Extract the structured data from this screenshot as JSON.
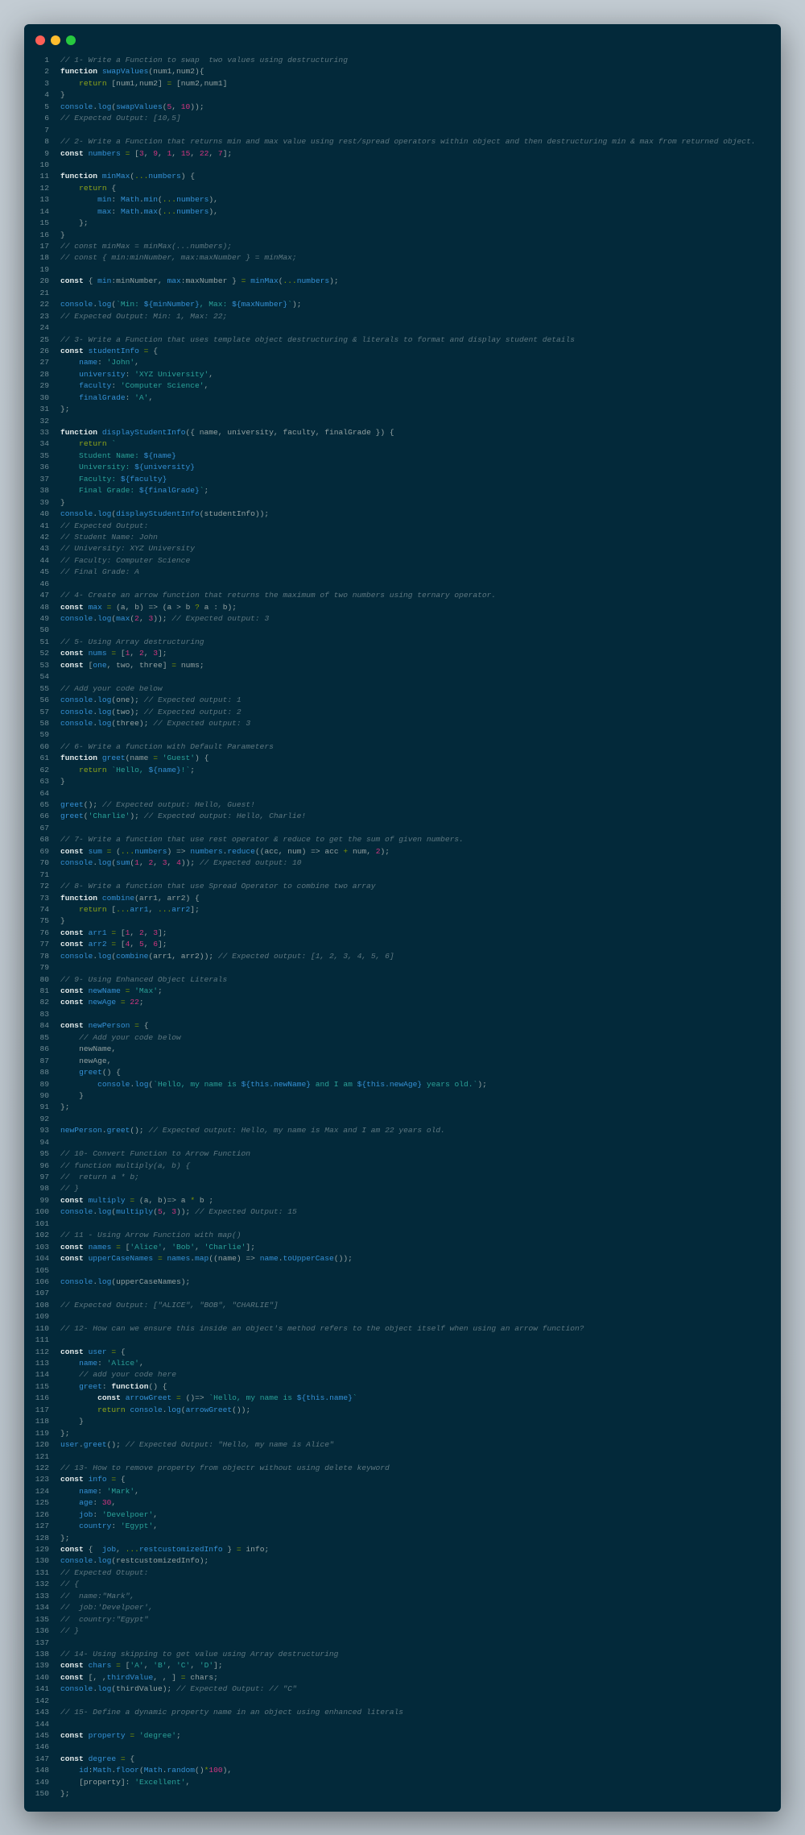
{
  "window": {
    "controls": [
      {
        "name": "close",
        "color": "#ff5f56"
      },
      {
        "name": "minimize",
        "color": "#ffbd2e"
      },
      {
        "name": "zoom",
        "color": "#27c93f"
      }
    ]
  },
  "theme": {
    "background": "#03293a",
    "keyword": "#e4ebeb",
    "identifier": "#3591d6",
    "string": "#2aa198",
    "number": "#d33682",
    "comment": "#5d7780"
  },
  "code": {
    "lines": [
      "// 1- Write a Function to swap  two values using destructuring",
      "function swapValues(num1,num2){",
      "    return [num1,num2] = [num2,num1]",
      "}",
      "console.log(swapValues(5, 10));",
      "// Expected Output: [10,5]",
      "",
      "// 2- Write a Function that returns min and max value using rest/spread operators within object and then destructuring min & max from returned object.",
      "const numbers = [3, 9, 1, 15, 22, 7];",
      "",
      "function minMax(...numbers) {",
      "    return {",
      "        min: Math.min(...numbers),",
      "        max: Math.max(...numbers),",
      "    };",
      "}",
      "// const minMax = minMax(...numbers);",
      "// const { min:minNumber, max:maxNumber } = minMax;",
      "",
      "const { min:minNumber, max:maxNumber } = minMax(...numbers);",
      "",
      "console.log(`Min: ${minNumber}, Max: ${maxNumber}`);",
      "// Expected Output: Min: 1, Max: 22;",
      "",
      "// 3- Write a Function that uses template object destructuring & literals to format and display student details",
      "const studentInfo = {",
      "    name: 'John',",
      "    university: 'XYZ University',",
      "    faculty: 'Computer Science',",
      "    finalGrade: 'A',",
      "};",
      "",
      "function displayStudentInfo({ name, university, faculty, finalGrade }) {",
      "    return `",
      "    Student Name: ${name}",
      "    University: ${university}",
      "    Faculty: ${faculty}",
      "    Final Grade: ${finalGrade}`;",
      "}",
      "console.log(displayStudentInfo(studentInfo));",
      "// Expected Output:",
      "// Student Name: John",
      "// University: XYZ University",
      "// Faculty: Computer Science",
      "// Final Grade: A",
      "",
      "// 4- Create an arrow function that returns the maximum of two numbers using ternary operator.",
      "const max = (a, b) => (a > b ? a : b);",
      "console.log(max(2, 3)); // Expected output: 3",
      "",
      "// 5- Using Array destructuring",
      "const nums = [1, 2, 3];",
      "const [one, two, three] = nums;",
      "",
      "// Add your code below",
      "console.log(one); // Expected output: 1",
      "console.log(two); // Expected output: 2",
      "console.log(three); // Expected output: 3",
      "",
      "// 6- Write a function with Default Parameters",
      "function greet(name = 'Guest') {",
      "    return `Hello, ${name}!`;",
      "}",
      "",
      "greet(); // Expected output: Hello, Guest!",
      "greet('Charlie'); // Expected output: Hello, Charlie!",
      "",
      "// 7- Write a function that use rest operator & reduce to get the sum of given numbers.",
      "const sum = (...numbers) => numbers.reduce((acc, num) => acc + num, 2);",
      "console.log(sum(1, 2, 3, 4)); // Expected output: 10",
      "",
      "// 8- Write a function that use Spread Operator to combine two array",
      "function combine(arr1, arr2) {",
      "    return [...arr1, ...arr2];",
      "}",
      "const arr1 = [1, 2, 3];",
      "const arr2 = [4, 5, 6];",
      "console.log(combine(arr1, arr2)); // Expected output: [1, 2, 3, 4, 5, 6]",
      "",
      "// 9- Using Enhanced Object Literals",
      "const newName = 'Max';",
      "const newAge = 22;",
      "",
      "const newPerson = {",
      "    // Add your code below",
      "    newName,",
      "    newAge,",
      "    greet() {",
      "        console.log(`Hello, my name is ${this.newName} and I am ${this.newAge} years old.`);",
      "    }",
      "};",
      "",
      "newPerson.greet(); // Expected output: Hello, my name is Max and I am 22 years old.",
      "",
      "// 10- Convert Function to Arrow Function",
      "// function multiply(a, b) {",
      "//  return a * b;",
      "// }",
      "const multiply = (a, b)=> a * b ;",
      "console.log(multiply(5, 3)); // Expected Output: 15",
      "",
      "// 11 - Using Arrow Function with map()",
      "const names = ['Alice', 'Bob', 'Charlie'];",
      "const upperCaseNames = names.map((name) => name.toUpperCase());",
      "",
      "console.log(upperCaseNames);",
      "",
      "// Expected Output: [\"ALICE\", \"BOB\", \"CHARLIE\"]",
      "",
      "// 12- How can we ensure this inside an object's method refers to the object itself when using an arrow function?",
      "",
      "const user = {",
      "    name: 'Alice',",
      "    // add your code here",
      "    greet: function() {",
      "        const arrowGreet = ()=> `Hello, my name is ${this.name}`",
      "        return console.log(arrowGreet());",
      "    }",
      "};",
      "user.greet(); // Expected Output: \"Hello, my name is Alice\"",
      "",
      "// 13- How to remove property from objectr without using delete keyword",
      "const info = {",
      "    name: 'Mark',",
      "    age: 30,",
      "    job: 'Develpoer',",
      "    country: 'Egypt',",
      "};",
      "const {  job, ...restcustomizedInfo } = info;",
      "console.log(restcustomizedInfo);",
      "// Expected Otuput:",
      "// {",
      "//  name:\"Mark\",",
      "//  job:'Develpoer',",
      "//  country:\"Egypt\"",
      "// }",
      "",
      "// 14- Using skipping to get value using Array destructuring",
      "const chars = ['A', 'B', 'C', 'D'];",
      "const [, ,thirdValue, , ] = chars;",
      "console.log(thirdValue); // Expected Output: // \"C\"",
      "",
      "// 15- Define a dynamic property name in an object using enhanced literals",
      "",
      "const property = 'degree';",
      "",
      "const degree = {",
      "    id:Math.floor(Math.random()*100),",
      "    [property]: 'Excellent',",
      "};"
    ]
  }
}
